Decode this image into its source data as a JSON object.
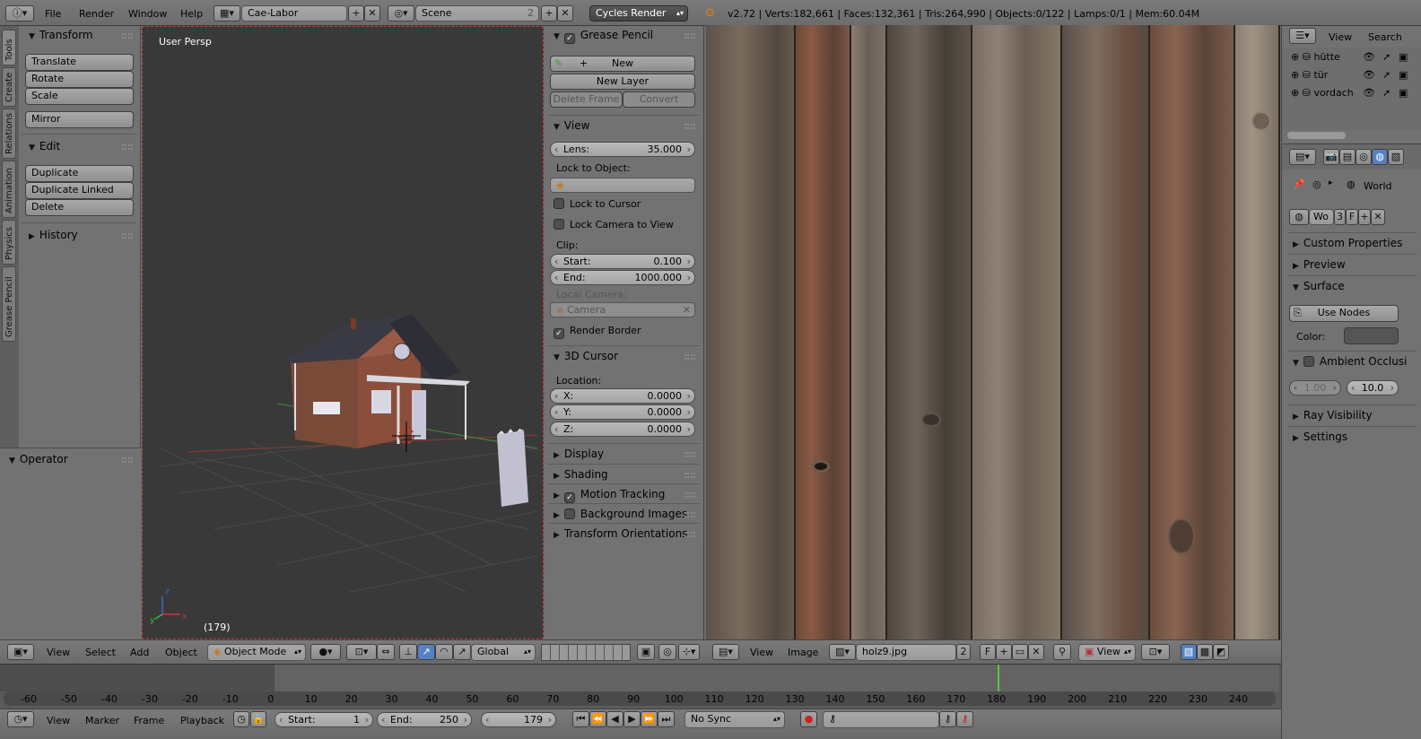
{
  "topbar": {
    "menus": [
      "File",
      "Render",
      "Window",
      "Help"
    ],
    "screen_layout": "Cae-Labor",
    "scene": "Scene",
    "scene_users": "2",
    "render_engine": "Cycles Render",
    "stats": "v2.72 | Verts:182,661 | Faces:132,361 | Tris:264,990 | Objects:0/122 | Lamps:0/1 | Mem:60.04M"
  },
  "tool_tabs": [
    "Tools",
    "Create",
    "Relations",
    "Animation",
    "Physics",
    "Grease Pencil"
  ],
  "toolshelf": {
    "transform_title": "Transform",
    "translate": "Translate",
    "rotate": "Rotate",
    "scale": "Scale",
    "mirror": "Mirror",
    "edit_title": "Edit",
    "duplicate": "Duplicate",
    "duplicate_linked": "Duplicate Linked",
    "delete": "Delete",
    "history_title": "History",
    "operator_title": "Operator"
  },
  "viewport": {
    "label": "User Persp",
    "frame_indicator": "(179)"
  },
  "properties_panel": {
    "grease_pencil": "Grease Pencil",
    "new": "New",
    "new_layer": "New Layer",
    "delete_frame": "Delete Frame",
    "convert": "Convert",
    "view_title": "View",
    "lens_label": "Lens:",
    "lens_value": "35.000",
    "lock_to_object": "Lock to Object:",
    "lock_to_cursor": "Lock to Cursor",
    "lock_camera": "Lock Camera to View",
    "clip_label": "Clip:",
    "clip_start_label": "Start:",
    "clip_start": "0.100",
    "clip_end_label": "End:",
    "clip_end": "1000.000",
    "local_camera": "Local Camera:",
    "camera": "Camera",
    "render_border": "Render Border",
    "cursor_title": "3D Cursor",
    "location": "Location:",
    "x_label": "X:",
    "x_value": "0.0000",
    "y_label": "Y:",
    "y_value": "0.0000",
    "z_label": "Z:",
    "z_value": "0.0000",
    "display": "Display",
    "shading": "Shading",
    "motion_tracking": "Motion Tracking",
    "background_images": "Background Images",
    "transform_orientations": "Transform Orientations"
  },
  "outliner": {
    "view": "View",
    "search": "Search",
    "items": [
      "hütte",
      "tür",
      "vordach"
    ]
  },
  "world_props": {
    "world_label": "World",
    "world_short": "Wo",
    "world_users": "3",
    "fake_user": "F",
    "custom_properties": "Custom Properties",
    "preview": "Preview",
    "surface": "Surface",
    "use_nodes": "Use Nodes",
    "color_label": "Color:",
    "ambient_occlusion": "Ambient Occlusi",
    "ao_factor": "1.00",
    "ao_distance": "10.0",
    "ray_visibility": "Ray Visibility",
    "settings": "Settings"
  },
  "view3d_header": {
    "menus": [
      "View",
      "Select",
      "Add",
      "Object"
    ],
    "mode": "Object Mode",
    "orientation": "Global"
  },
  "image_header": {
    "menus": [
      "View",
      "Image"
    ],
    "image_name": "holz9.jpg",
    "image_users": "2",
    "fake_user": "F",
    "view_mode": "View"
  },
  "timeline": {
    "ruler": [
      "-60",
      "-50",
      "-40",
      "-30",
      "-20",
      "-10",
      "0",
      "10",
      "20",
      "30",
      "40",
      "50",
      "60",
      "70",
      "80",
      "90",
      "100",
      "110",
      "120",
      "130",
      "140",
      "150",
      "160",
      "170",
      "180",
      "190",
      "200",
      "210",
      "220",
      "230",
      "240"
    ],
    "current_frame": 180,
    "menus": [
      "View",
      "Marker",
      "Frame",
      "Playback"
    ],
    "start_label": "Start:",
    "start": "1",
    "end_label": "End:",
    "end": "250",
    "frame": "179",
    "sync": "No Sync"
  },
  "colors": {
    "viewport_bg": "#393939",
    "panel_bg": "#727272",
    "header_bg": "#727272",
    "active_blue": "#5680c2",
    "frame_line": "#60c040"
  }
}
